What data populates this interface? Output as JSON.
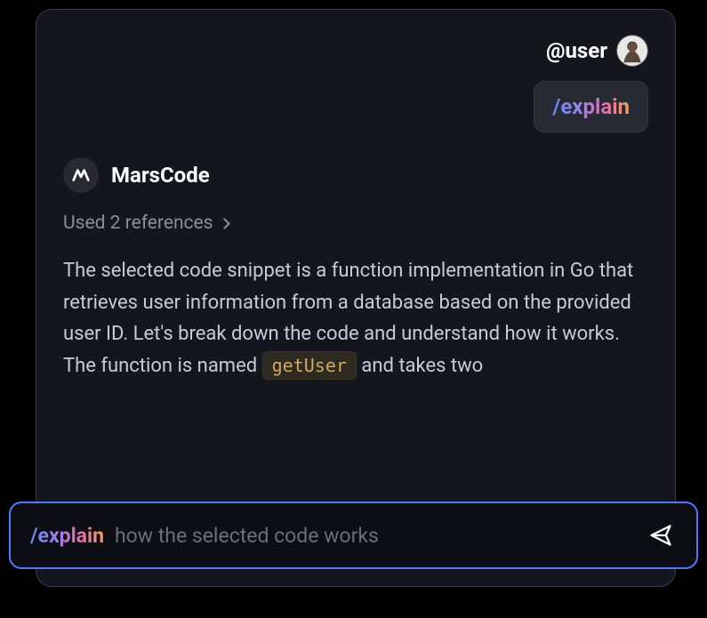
{
  "user": {
    "name": "@user"
  },
  "userMessage": {
    "command": "/explain"
  },
  "assistant": {
    "name": "MarsCode",
    "referencesText": "Used 2 references",
    "response": {
      "para1": "The selected code snippet is a function implementation in Go that retrieves user information from a database based on the provided user ID. Let's break down the code and understand how it works.",
      "para2_before": "The function is named ",
      "para2_code": "getUser",
      "para2_after": " and takes two"
    }
  },
  "input": {
    "command": "/explain",
    "placeholder": "how the selected code works"
  }
}
